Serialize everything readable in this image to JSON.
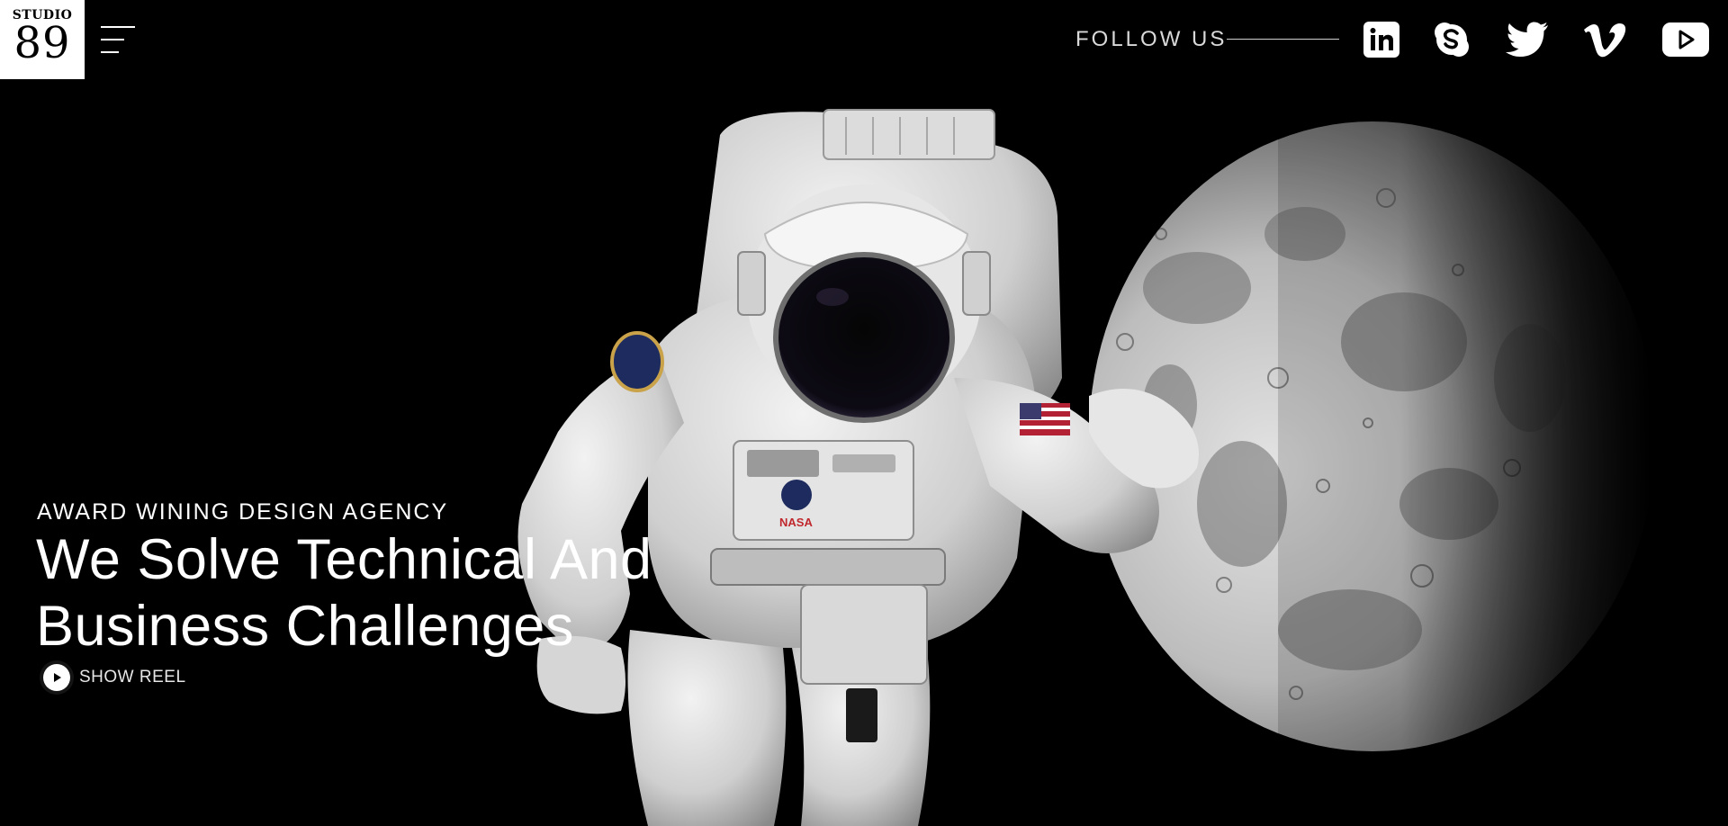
{
  "logo": {
    "line1": "STUDIO",
    "line2": "89"
  },
  "header": {
    "follow_label": "FOLLOW US",
    "social": [
      {
        "name": "linkedin",
        "icon": "linkedin-icon"
      },
      {
        "name": "skype",
        "icon": "skype-icon"
      },
      {
        "name": "twitter",
        "icon": "twitter-icon"
      },
      {
        "name": "vimeo",
        "icon": "vimeo-icon"
      },
      {
        "name": "youtube",
        "icon": "youtube-icon"
      }
    ]
  },
  "hero": {
    "eyebrow": "AWARD WINING DESIGN AGENCY",
    "headline_line1": "We Solve Technical And",
    "headline_line2": "Business Challenges",
    "reel_label": "SHOW REEL"
  },
  "colors": {
    "background": "#000000",
    "text": "#ffffff",
    "logo_bg": "#ffffff"
  }
}
